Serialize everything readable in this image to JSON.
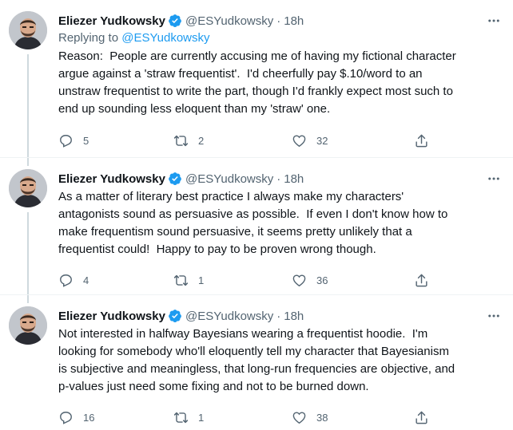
{
  "colors": {
    "text": "#0f1419",
    "secondary": "#536471",
    "link": "#1d9bf0",
    "verified": "#1d9bf0",
    "divider": "#eff3f4",
    "thread_line": "#cfd9de"
  },
  "tweets": [
    {
      "name": "Eliezer Yudkowsky",
      "handle": "@ESYudkowsky",
      "separator": "·",
      "time": "18h",
      "replying_prefix": "Replying to ",
      "replying_handle": "@ESYudkowsky",
      "text": "Reason:  People are currently accusing me of having my fictional character\nargue against a 'straw frequentist'.  I'd cheerfully pay $.10/word to an\nunstraw frequentist to write the part, though I'd frankly expect most such to\nend up sounding less eloquent than my 'straw' one.",
      "replies": "5",
      "retweets": "2",
      "likes": "32"
    },
    {
      "name": "Eliezer Yudkowsky",
      "handle": "@ESYudkowsky",
      "separator": "·",
      "time": "18h",
      "text": "As a matter of literary best practice I always make my characters'\nantagonists sound as persuasive as possible.  If even I don't know how to\nmake frequentism sound persuasive, it seems pretty unlikely that a\nfrequentist could!  Happy to pay to be proven wrong though.",
      "replies": "4",
      "retweets": "1",
      "likes": "36"
    },
    {
      "name": "Eliezer Yudkowsky",
      "handle": "@ESYudkowsky",
      "separator": "·",
      "time": "18h",
      "text": "Not interested in halfway Bayesians wearing a frequentist hoodie.  I'm\nlooking for somebody who'll eloquently tell my character that Bayesianism\nis subjective and meaningless, that long-run frequencies are objective, and\np-values just need some fixing and not to be burned down.",
      "replies": "16",
      "retweets": "1",
      "likes": "38"
    }
  ],
  "icons": {
    "verified": "verified-badge-icon",
    "more": "more-options-icon",
    "reply": "reply-bubble-icon",
    "retweet": "retweet-arrows-icon",
    "like": "heart-icon",
    "share": "share-upload-icon"
  }
}
